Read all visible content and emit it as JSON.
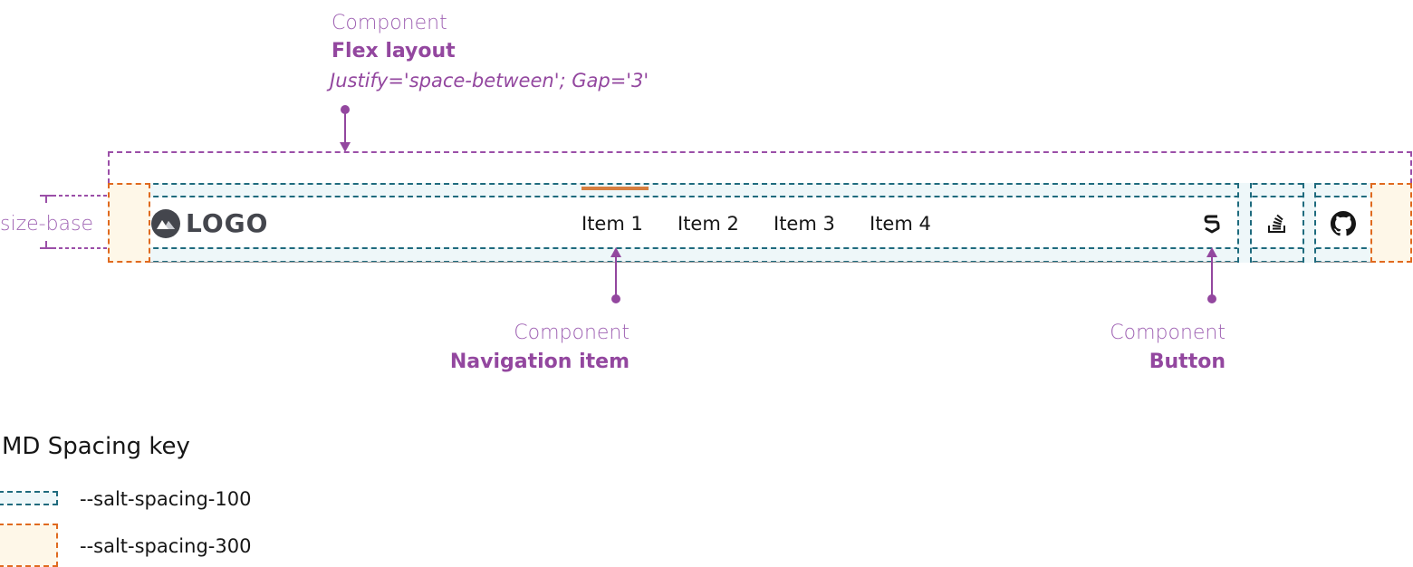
{
  "annotations": {
    "flex_layout": {
      "kind": "Component",
      "name": "Flex layout",
      "props": "Justify='space-between'; Gap='3'"
    },
    "size_base": "size-base",
    "navigation_item": {
      "kind": "Component",
      "name": "Navigation item"
    },
    "button": {
      "kind": "Component",
      "name": "Button"
    }
  },
  "navbar": {
    "logo": {
      "icon": "mountain-icon",
      "text": "LOGO"
    },
    "items": [
      {
        "label": "Item 1",
        "active": true
      },
      {
        "label": "Item 2",
        "active": false
      },
      {
        "label": "Item 3",
        "active": false
      },
      {
        "label": "Item 4",
        "active": false
      }
    ],
    "actions": [
      {
        "icon": "salt-icon"
      },
      {
        "icon": "stackoverflow-icon"
      },
      {
        "icon": "github-icon"
      }
    ],
    "active_indicator_color": "#d67e3f"
  },
  "legend": {
    "title": "MD Spacing key",
    "entries": [
      {
        "label": "--salt-spacing-100",
        "color": "#1f6b7e",
        "fill": "#eef7f9"
      },
      {
        "label": "--salt-spacing-300",
        "color": "#e06a1f",
        "fill": "#fef7e8"
      }
    ]
  },
  "colors": {
    "annotation": "#93479f",
    "spacing_100": "#1f6b7e",
    "spacing_300": "#e06a1f"
  }
}
